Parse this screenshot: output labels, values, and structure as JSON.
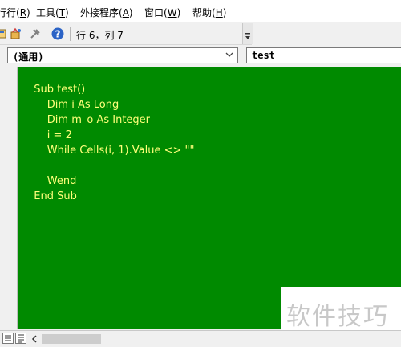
{
  "menu": {
    "run": {
      "text": "行行",
      "key": "R"
    },
    "tools": {
      "text": "工具",
      "key": "T"
    },
    "addins": {
      "text": "外接程序",
      "key": "A"
    },
    "window": {
      "text": "窗口",
      "key": "W"
    },
    "help": {
      "text": "帮助",
      "key": "H"
    }
  },
  "toolbar": {
    "position_text": "行 6，列 7"
  },
  "combos": {
    "object": "(通用)",
    "procedure": "test"
  },
  "code": {
    "lines": [
      "Sub test()",
      "    Dim i As Long",
      "    Dim m_o As Integer",
      "    i = 2",
      "    While Cells(i, 1).Value <> \"\"",
      "",
      "    Wend",
      "End Sub"
    ]
  },
  "watermark": "软件技巧",
  "colors": {
    "editor_bg": "#008a00",
    "keyword": "#ffff7a",
    "identifier": "#ffffff"
  }
}
